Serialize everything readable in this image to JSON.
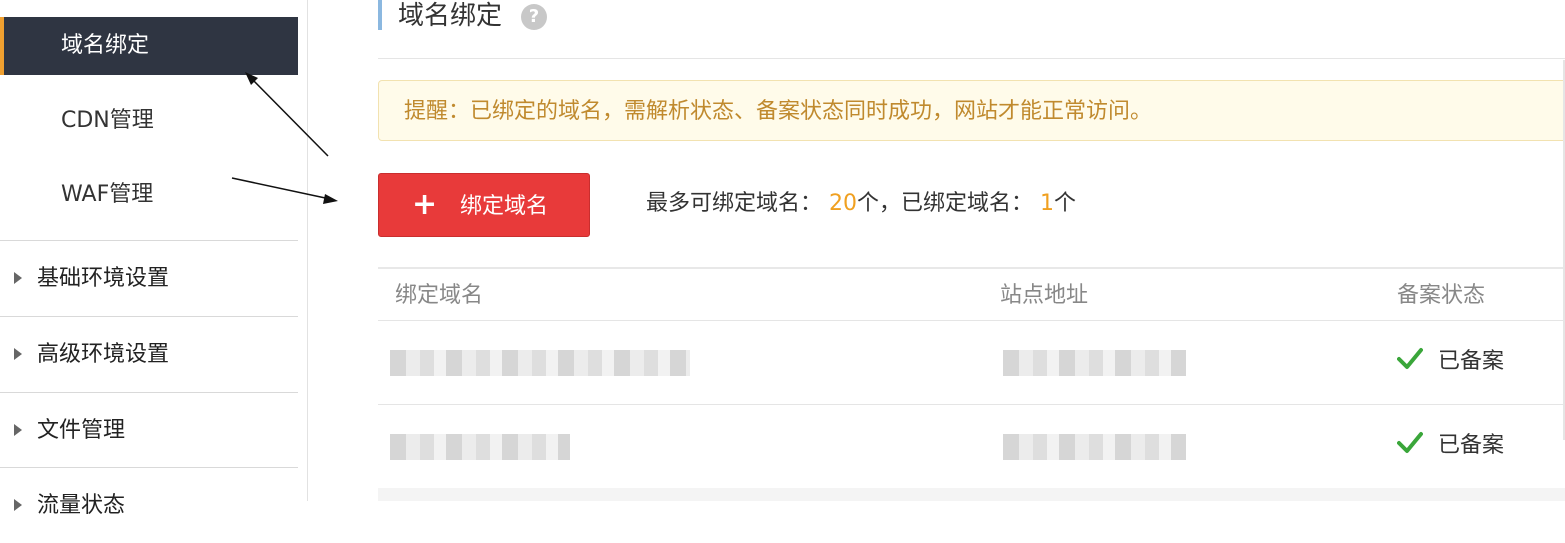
{
  "sidebar": {
    "sub_items": [
      {
        "label": "域名绑定",
        "active": true
      },
      {
        "label": "CDN管理",
        "active": false
      },
      {
        "label": "WAF管理",
        "active": false
      }
    ],
    "groups": [
      {
        "label": "基础环境设置"
      },
      {
        "label": "高级环境设置"
      },
      {
        "label": "文件管理"
      },
      {
        "label": "流量状态"
      }
    ]
  },
  "main": {
    "title": "域名绑定",
    "help_icon": "?",
    "notice": "提醒：已绑定的域名，需解析状态、备案状态同时成功，网站才能正常访问。",
    "add_button": {
      "icon": "+",
      "label": "绑定域名"
    },
    "stats": {
      "max_label": "最多可绑定域名：",
      "max_value": "20",
      "unit1": "个，已绑定域名：",
      "bound_value": "1",
      "unit2": "个"
    },
    "table": {
      "headers": [
        "绑定域名",
        "站点地址",
        "备案状态"
      ],
      "rows": [
        {
          "status": "已备案"
        },
        {
          "status": "已备案"
        }
      ]
    }
  },
  "colors": {
    "accent_orange": "#f0a030",
    "button_red": "#e83a3a",
    "notice_text": "#c08a2e",
    "check_green": "#3aa63a"
  }
}
